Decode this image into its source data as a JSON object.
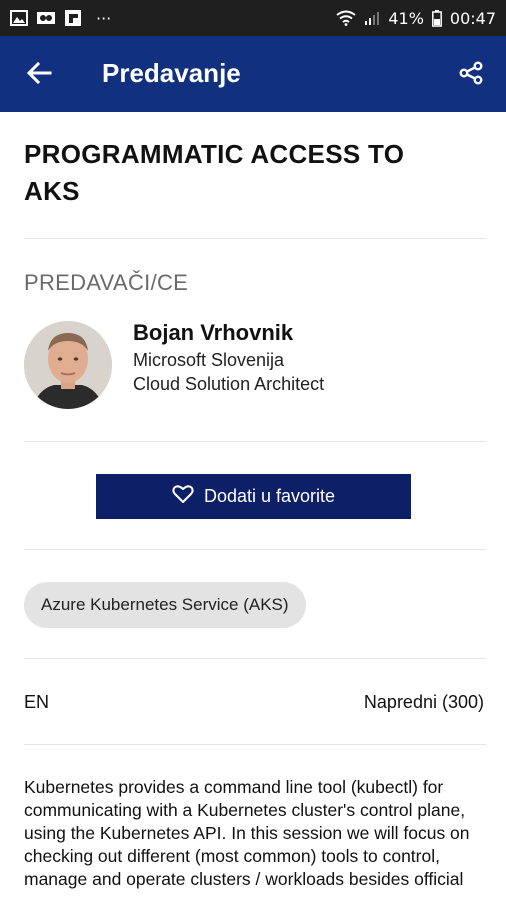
{
  "status_bar": {
    "battery": "41%",
    "time": "00:47",
    "more": "···",
    "icons": [
      "gallery-icon",
      "video-icon",
      "flipboard-icon",
      "wifi-icon",
      "signal-icon",
      "battery-icon"
    ]
  },
  "app_bar": {
    "title": "Predavanje",
    "back_icon": "arrow-left-icon",
    "share_icon": "share-icon",
    "background": "#113080"
  },
  "session": {
    "title": "PROGRAMMATIC ACCESS TO AKS"
  },
  "speakers": {
    "label": "PREDAVAČI/CE",
    "items": [
      {
        "name": "Bojan Vrhovnik",
        "organization": "Microsoft Slovenija",
        "role": "Cloud Solution Architect"
      }
    ]
  },
  "favorite_button": {
    "label": "Dodati u favorite",
    "icon": "heart-outline-icon",
    "background": "#0d1f66"
  },
  "tags": [
    "Azure Kubernetes Service (AKS)"
  ],
  "meta": {
    "language": "EN",
    "level": "Napredni (300)"
  },
  "description": "Kubernetes provides a command line tool (kubectl) for communicating with a Kubernetes cluster's control plane, using the Kubernetes API. In this session we will focus on checking out different (most common) tools to control, manage and operate clusters / workloads besides official"
}
